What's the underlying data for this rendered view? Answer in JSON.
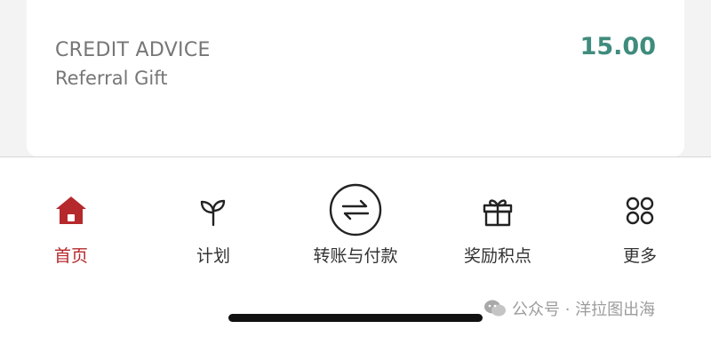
{
  "transaction": {
    "type": "CREDIT ADVICE",
    "description": "Referral Gift",
    "amount": "15.00"
  },
  "tabbar": {
    "items": [
      {
        "label": "首页",
        "icon": "home-icon",
        "active": true
      },
      {
        "label": "计划",
        "icon": "sprout-icon",
        "active": false
      },
      {
        "label": "转账与付款",
        "icon": "transfer-icon",
        "active": false
      },
      {
        "label": "奖励积点",
        "icon": "gift-icon",
        "active": false
      },
      {
        "label": "更多",
        "icon": "more-grid-icon",
        "active": false
      }
    ]
  },
  "watermark": {
    "text": "公众号 · 洋拉图出海"
  },
  "colors": {
    "accent": "#b5282c",
    "amount": "#3f8c7d",
    "text_muted": "#767676"
  }
}
